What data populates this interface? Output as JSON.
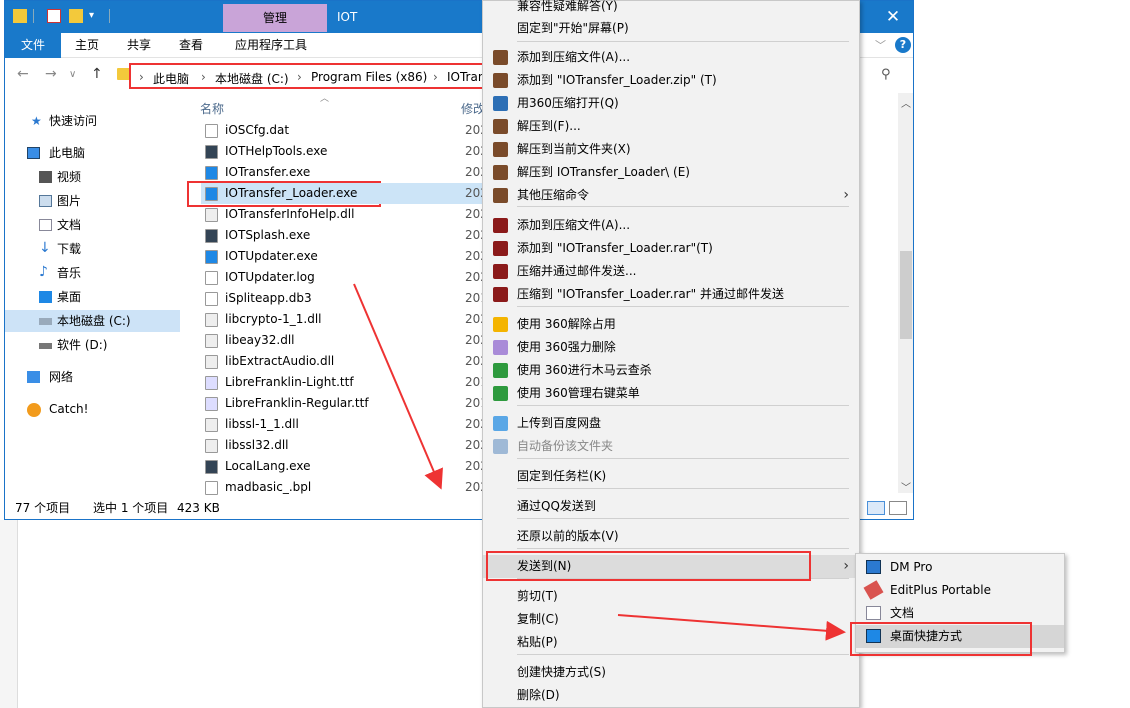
{
  "window": {
    "title": "IOT",
    "manage_tab": "管理",
    "close_glyph": "✕",
    "help_glyph": "?"
  },
  "ribbon": {
    "tabs": [
      "文件",
      "主页",
      "共享",
      "查看",
      "应用程序工具"
    ]
  },
  "address": {
    "crumbs": [
      "此电脑",
      "本地磁盘 (C:)",
      "Program Files (x86)",
      "IOTran"
    ]
  },
  "sidebar": {
    "items": [
      {
        "label": "快速访问",
        "icon": "star-icon"
      },
      {
        "label": "此电脑",
        "icon": "computer-icon"
      },
      {
        "label": "视频",
        "icon": "video-icon"
      },
      {
        "label": "图片",
        "icon": "picture-icon"
      },
      {
        "label": "文档",
        "icon": "document-icon"
      },
      {
        "label": "下载",
        "icon": "download-icon"
      },
      {
        "label": "音乐",
        "icon": "music-icon"
      },
      {
        "label": "桌面",
        "icon": "desktop-icon"
      },
      {
        "label": "本地磁盘 (C:)",
        "icon": "drive-icon"
      },
      {
        "label": "软件 (D:)",
        "icon": "drive-icon"
      },
      {
        "label": "网络",
        "icon": "network-icon"
      },
      {
        "label": "Catch!",
        "icon": "catch-icon"
      }
    ]
  },
  "files": {
    "col_name": "名称",
    "col_modified": "修改",
    "rows": [
      {
        "name": "iOSCfg.dat",
        "date": "202"
      },
      {
        "name": "IOTHelpTools.exe",
        "date": "202"
      },
      {
        "name": "IOTransfer.exe",
        "date": "202"
      },
      {
        "name": "IOTransfer_Loader.exe",
        "date": "202"
      },
      {
        "name": "IOTransferInfoHelp.dll",
        "date": "202"
      },
      {
        "name": "IOTSplash.exe",
        "date": "202"
      },
      {
        "name": "IOTUpdater.exe",
        "date": "202"
      },
      {
        "name": "IOTUpdater.log",
        "date": "202"
      },
      {
        "name": "iSpliteapp.db3",
        "date": "201"
      },
      {
        "name": "libcrypto-1_1.dll",
        "date": "202"
      },
      {
        "name": "libeay32.dll",
        "date": "202"
      },
      {
        "name": "libExtractAudio.dll",
        "date": "202"
      },
      {
        "name": "LibreFranklin-Light.ttf",
        "date": "201"
      },
      {
        "name": "LibreFranklin-Regular.ttf",
        "date": "201"
      },
      {
        "name": "libssl-1_1.dll",
        "date": "202"
      },
      {
        "name": "libssl32.dll",
        "date": "202"
      },
      {
        "name": "LocalLang.exe",
        "date": "202"
      },
      {
        "name": "madbasic_.bpl",
        "date": "202"
      }
    ]
  },
  "status": {
    "count": "77 个项目",
    "selected": "选中 1 个项目",
    "size": "423 KB"
  },
  "context_menu": {
    "items": [
      "兼容性疑难解答(Y)",
      "固定到\"开始\"屏幕(P)",
      "添加到压缩文件(A)...",
      "添加到 \"IOTransfer_Loader.zip\" (T)",
      "用360压缩打开(Q)",
      "解压到(F)...",
      "解压到当前文件夹(X)",
      "解压到 IOTransfer_Loader\\ (E)",
      "其他压缩命令",
      "添加到压缩文件(A)...",
      "添加到 \"IOTransfer_Loader.rar\"(T)",
      "压缩并通过邮件发送...",
      "压缩到 \"IOTransfer_Loader.rar\" 并通过邮件发送",
      "使用 360解除占用",
      "使用 360强力删除",
      "使用 360进行木马云查杀",
      "使用 360管理右键菜单",
      "上传到百度网盘",
      "自动备份该文件夹",
      "固定到任务栏(K)",
      "通过QQ发送到",
      "还原以前的版本(V)",
      "发送到(N)",
      "剪切(T)",
      "复制(C)",
      "粘贴(P)",
      "创建快捷方式(S)",
      "删除(D)"
    ]
  },
  "sendto_menu": {
    "items": [
      "DM Pro",
      "EditPlus Portable",
      "文档",
      "桌面快捷方式"
    ]
  },
  "colors": {
    "accent": "#1979ca",
    "highlight_box": "#e33333",
    "manage_tab": "#c9a4d8"
  }
}
